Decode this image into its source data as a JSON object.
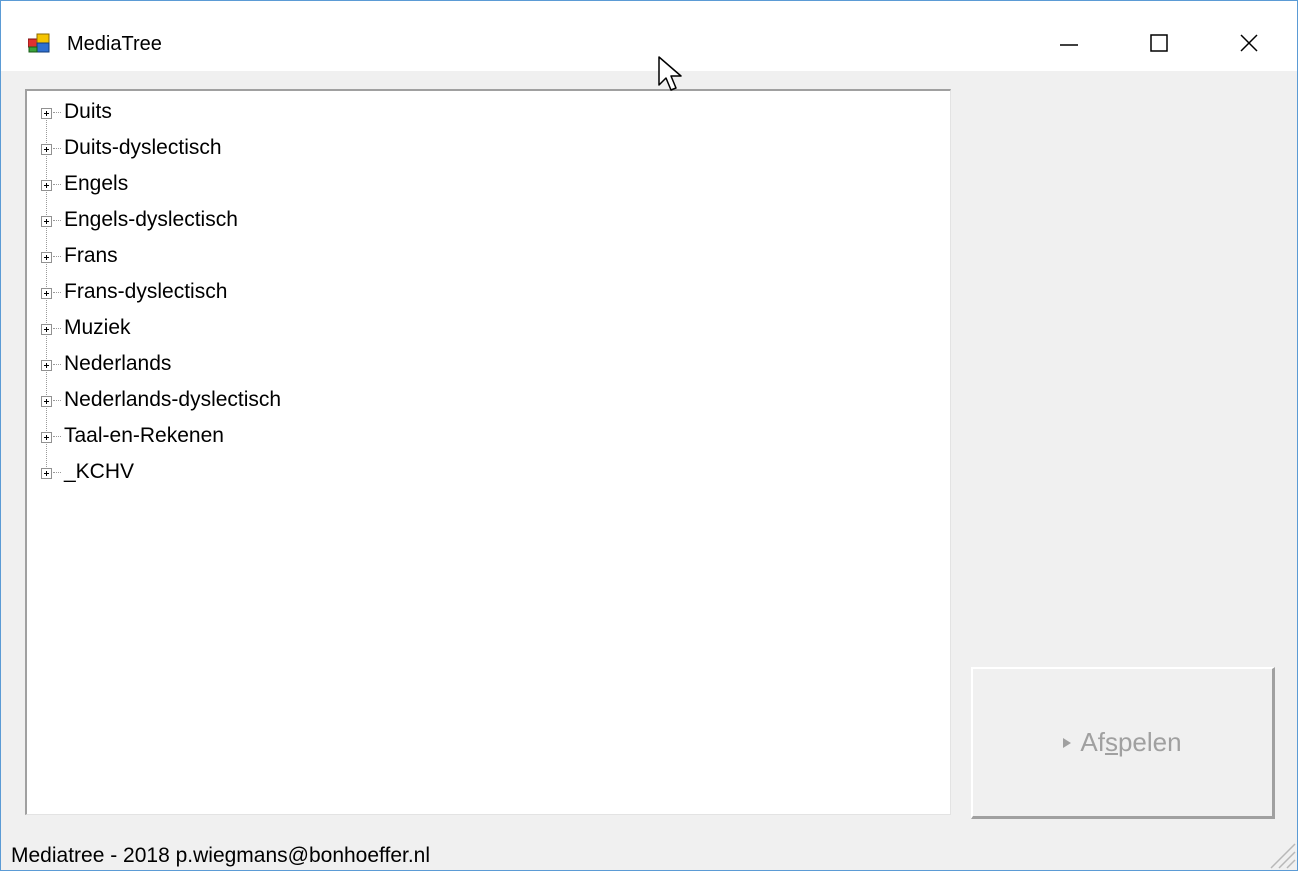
{
  "window": {
    "title": "MediaTree",
    "app_icon": "windows-forms-app-icon",
    "controls": [
      "minimize-icon",
      "maximize-icon",
      "close-icon"
    ]
  },
  "tree": {
    "items": [
      {
        "label": "Duits"
      },
      {
        "label": "Duits-dyslectisch"
      },
      {
        "label": "Engels"
      },
      {
        "label": "Engels-dyslectisch"
      },
      {
        "label": "Frans"
      },
      {
        "label": "Frans-dyslectisch"
      },
      {
        "label": "Muziek"
      },
      {
        "label": "Nederlands"
      },
      {
        "label": "Nederlands-dyslectisch"
      },
      {
        "label": "Taal-en-Rekenen"
      },
      {
        "label": "_KCHV"
      }
    ]
  },
  "play_button": {
    "label_pre": "Af",
    "label_mnemonic": "s",
    "label_post": "pelen",
    "icon": "play-icon",
    "enabled": false
  },
  "status_bar": {
    "text": "Mediatree - 2018 p.wiegmans@bonhoeffer.nl"
  },
  "colors": {
    "window_border": "#5b9bd5",
    "form_background": "#f0f0f0",
    "disabled_text": "#a0a0a0"
  }
}
